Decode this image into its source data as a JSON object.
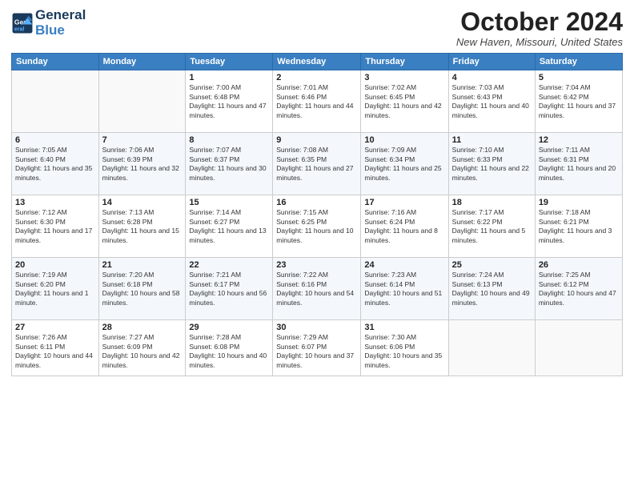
{
  "header": {
    "logo_line1": "General",
    "logo_line2": "Blue",
    "month": "October 2024",
    "location": "New Haven, Missouri, United States"
  },
  "days_of_week": [
    "Sunday",
    "Monday",
    "Tuesday",
    "Wednesday",
    "Thursday",
    "Friday",
    "Saturday"
  ],
  "weeks": [
    [
      {
        "day": "",
        "info": ""
      },
      {
        "day": "",
        "info": ""
      },
      {
        "day": "1",
        "info": "Sunrise: 7:00 AM\nSunset: 6:48 PM\nDaylight: 11 hours and 47 minutes."
      },
      {
        "day": "2",
        "info": "Sunrise: 7:01 AM\nSunset: 6:46 PM\nDaylight: 11 hours and 44 minutes."
      },
      {
        "day": "3",
        "info": "Sunrise: 7:02 AM\nSunset: 6:45 PM\nDaylight: 11 hours and 42 minutes."
      },
      {
        "day": "4",
        "info": "Sunrise: 7:03 AM\nSunset: 6:43 PM\nDaylight: 11 hours and 40 minutes."
      },
      {
        "day": "5",
        "info": "Sunrise: 7:04 AM\nSunset: 6:42 PM\nDaylight: 11 hours and 37 minutes."
      }
    ],
    [
      {
        "day": "6",
        "info": "Sunrise: 7:05 AM\nSunset: 6:40 PM\nDaylight: 11 hours and 35 minutes."
      },
      {
        "day": "7",
        "info": "Sunrise: 7:06 AM\nSunset: 6:39 PM\nDaylight: 11 hours and 32 minutes."
      },
      {
        "day": "8",
        "info": "Sunrise: 7:07 AM\nSunset: 6:37 PM\nDaylight: 11 hours and 30 minutes."
      },
      {
        "day": "9",
        "info": "Sunrise: 7:08 AM\nSunset: 6:35 PM\nDaylight: 11 hours and 27 minutes."
      },
      {
        "day": "10",
        "info": "Sunrise: 7:09 AM\nSunset: 6:34 PM\nDaylight: 11 hours and 25 minutes."
      },
      {
        "day": "11",
        "info": "Sunrise: 7:10 AM\nSunset: 6:33 PM\nDaylight: 11 hours and 22 minutes."
      },
      {
        "day": "12",
        "info": "Sunrise: 7:11 AM\nSunset: 6:31 PM\nDaylight: 11 hours and 20 minutes."
      }
    ],
    [
      {
        "day": "13",
        "info": "Sunrise: 7:12 AM\nSunset: 6:30 PM\nDaylight: 11 hours and 17 minutes."
      },
      {
        "day": "14",
        "info": "Sunrise: 7:13 AM\nSunset: 6:28 PM\nDaylight: 11 hours and 15 minutes."
      },
      {
        "day": "15",
        "info": "Sunrise: 7:14 AM\nSunset: 6:27 PM\nDaylight: 11 hours and 13 minutes."
      },
      {
        "day": "16",
        "info": "Sunrise: 7:15 AM\nSunset: 6:25 PM\nDaylight: 11 hours and 10 minutes."
      },
      {
        "day": "17",
        "info": "Sunrise: 7:16 AM\nSunset: 6:24 PM\nDaylight: 11 hours and 8 minutes."
      },
      {
        "day": "18",
        "info": "Sunrise: 7:17 AM\nSunset: 6:22 PM\nDaylight: 11 hours and 5 minutes."
      },
      {
        "day": "19",
        "info": "Sunrise: 7:18 AM\nSunset: 6:21 PM\nDaylight: 11 hours and 3 minutes."
      }
    ],
    [
      {
        "day": "20",
        "info": "Sunrise: 7:19 AM\nSunset: 6:20 PM\nDaylight: 11 hours and 1 minute."
      },
      {
        "day": "21",
        "info": "Sunrise: 7:20 AM\nSunset: 6:18 PM\nDaylight: 10 hours and 58 minutes."
      },
      {
        "day": "22",
        "info": "Sunrise: 7:21 AM\nSunset: 6:17 PM\nDaylight: 10 hours and 56 minutes."
      },
      {
        "day": "23",
        "info": "Sunrise: 7:22 AM\nSunset: 6:16 PM\nDaylight: 10 hours and 54 minutes."
      },
      {
        "day": "24",
        "info": "Sunrise: 7:23 AM\nSunset: 6:14 PM\nDaylight: 10 hours and 51 minutes."
      },
      {
        "day": "25",
        "info": "Sunrise: 7:24 AM\nSunset: 6:13 PM\nDaylight: 10 hours and 49 minutes."
      },
      {
        "day": "26",
        "info": "Sunrise: 7:25 AM\nSunset: 6:12 PM\nDaylight: 10 hours and 47 minutes."
      }
    ],
    [
      {
        "day": "27",
        "info": "Sunrise: 7:26 AM\nSunset: 6:11 PM\nDaylight: 10 hours and 44 minutes."
      },
      {
        "day": "28",
        "info": "Sunrise: 7:27 AM\nSunset: 6:09 PM\nDaylight: 10 hours and 42 minutes."
      },
      {
        "day": "29",
        "info": "Sunrise: 7:28 AM\nSunset: 6:08 PM\nDaylight: 10 hours and 40 minutes."
      },
      {
        "day": "30",
        "info": "Sunrise: 7:29 AM\nSunset: 6:07 PM\nDaylight: 10 hours and 37 minutes."
      },
      {
        "day": "31",
        "info": "Sunrise: 7:30 AM\nSunset: 6:06 PM\nDaylight: 10 hours and 35 minutes."
      },
      {
        "day": "",
        "info": ""
      },
      {
        "day": "",
        "info": ""
      }
    ]
  ]
}
